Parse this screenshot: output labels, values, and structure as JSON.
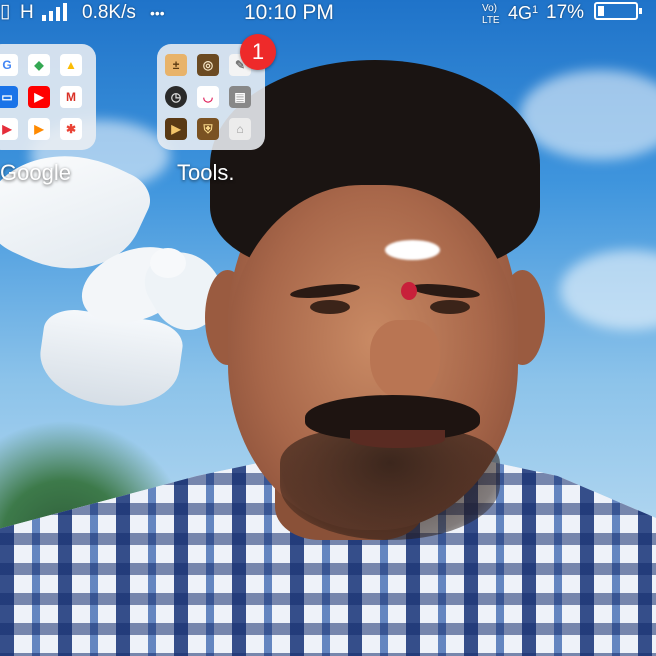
{
  "status_bar": {
    "network_type": "H",
    "data_speed": "0.8K/s",
    "more_indicator": "•••",
    "time": "10:10 PM",
    "volte_top": "Vo)",
    "volte_bottom": "LTE",
    "network_4g": "4G",
    "sim_index": "1",
    "battery_percent": "17%",
    "battery_level": 0.17
  },
  "folders": [
    {
      "label": "Google",
      "icons": [
        "google-icon",
        "maps-icon",
        "drive-icon",
        "duo-icon",
        "youtube-icon",
        "gmail-icon",
        "play-movies-icon",
        "play-music-icon",
        "photos-icon"
      ]
    },
    {
      "label": "Tools.",
      "badge": "1",
      "icons": [
        "calculator-icon",
        "compass-icon",
        "notes-icon",
        "clock-icon",
        "recorder-icon",
        "calendar-icon",
        "video-player-icon",
        "security-icon",
        "cleaner-icon"
      ]
    }
  ],
  "colors": {
    "badge": "#ee2a2a",
    "folder_bg": "#ebeef2"
  }
}
